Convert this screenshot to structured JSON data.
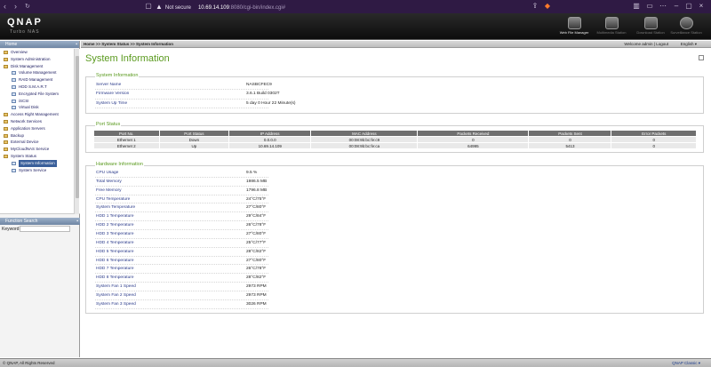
{
  "browser": {
    "back": "‹",
    "forward": "›",
    "reload": "↻",
    "security": "Not secure",
    "url_host": "10.69.14.109",
    "url_path": ":8080/cgi-bin/index.cgi#"
  },
  "header": {
    "logo": "QNAP",
    "subtitle": "Turbo NAS",
    "apps": [
      {
        "label": "Web File Manager"
      },
      {
        "label": "Multimedia Station"
      },
      {
        "label": "Download Station"
      },
      {
        "label": "Surveillance Station"
      }
    ]
  },
  "crumbbar": {
    "breadcrumb": "Home >> System Status >> System Information",
    "welcome": "Welcome admin | Logout",
    "language": "English ▾"
  },
  "sidebar": {
    "title": "Home",
    "items": [
      {
        "label": "Overview",
        "level": 0
      },
      {
        "label": "System Administration",
        "level": 0
      },
      {
        "label": "Disk Management",
        "level": 0
      },
      {
        "label": "Volume Management",
        "level": 1
      },
      {
        "label": "RAID Management",
        "level": 1
      },
      {
        "label": "HDD S.M.A.R.T",
        "level": 1
      },
      {
        "label": "Encrypted File System",
        "level": 1
      },
      {
        "label": "iSCSI",
        "level": 1
      },
      {
        "label": "Virtual Disk",
        "level": 1
      },
      {
        "label": "Access Right Management",
        "level": 0
      },
      {
        "label": "Network Services",
        "level": 0
      },
      {
        "label": "Application Servers",
        "level": 0
      },
      {
        "label": "Backup",
        "level": 0
      },
      {
        "label": "External Device",
        "level": 0
      },
      {
        "label": "MyCloudNAS Service",
        "level": 0
      },
      {
        "label": "System Status",
        "level": 0
      },
      {
        "label": "System Information",
        "level": 1
      },
      {
        "label": "System Service",
        "level": 1
      }
    ],
    "function_search": "Function Search",
    "keyword_label": "Keyword"
  },
  "main": {
    "title": "System Information",
    "system_info": {
      "section_title": "System Information",
      "rows": [
        {
          "label": "Server Name",
          "value": "NASBCFEC9"
        },
        {
          "label": "Firmware Version",
          "value": "3.6.1 Build 0302T"
        },
        {
          "label": "System Up Time",
          "value": "5 day 0 Hour 22 Minute(s)"
        }
      ]
    },
    "port_status": {
      "section_title": "Port Status",
      "columns": [
        "Port No.",
        "Port Status",
        "IP Address",
        "MAC Address",
        "Packets Received",
        "Packets Sent",
        "Error Packets"
      ],
      "rows": [
        [
          "Ethernet 1",
          "Down",
          "0.0.0.0",
          "00:08:9b:bc:fe:c9",
          "0",
          "0",
          "0"
        ],
        [
          "Ethernet 2",
          "Up",
          "10.69.14.109",
          "00:08:9b:bc:fe:ca",
          "64995",
          "5413",
          "0"
        ]
      ]
    },
    "hardware_info": {
      "section_title": "Hardware Information",
      "rows": [
        {
          "label": "CPU Usage",
          "value": "9.5 %"
        },
        {
          "label": "Total Memory",
          "value": "1986.5 MB"
        },
        {
          "label": "Free Memory",
          "value": "1796.8 MB"
        },
        {
          "label": "CPU Temperature",
          "value": "24°C/75°F"
        },
        {
          "label": "System Temperature",
          "value": "27°C/80°F"
        },
        {
          "label": "HDD 1 Temperature",
          "value": "29°C/84°F"
        },
        {
          "label": "HDD 2 Temperature",
          "value": "26°C/78°F"
        },
        {
          "label": "HDD 3 Temperature",
          "value": "27°C/80°F"
        },
        {
          "label": "HDD 4 Temperature",
          "value": "25°C/77°F"
        },
        {
          "label": "HDD 5 Temperature",
          "value": "28°C/82°F"
        },
        {
          "label": "HDD 6 Temperature",
          "value": "27°C/80°F"
        },
        {
          "label": "HDD 7 Temperature",
          "value": "26°C/78°F"
        },
        {
          "label": "HDD 8 Temperature",
          "value": "28°C/82°F"
        },
        {
          "label": "System Fan 1 Speed",
          "value": "2973 RPM"
        },
        {
          "label": "System Fan 2 Speed",
          "value": "2973 RPM"
        },
        {
          "label": "System Fan 3 Speed",
          "value": "3026 RPM"
        }
      ]
    }
  },
  "footer": {
    "copyright": "© QNAP, All Rights Reserved",
    "classic": "QNAP Classic ▾"
  },
  "colors": {
    "accent_green": "#5a9a1e",
    "label_blue": "#2a3a8a",
    "browser_bar": "#2f1a44"
  }
}
